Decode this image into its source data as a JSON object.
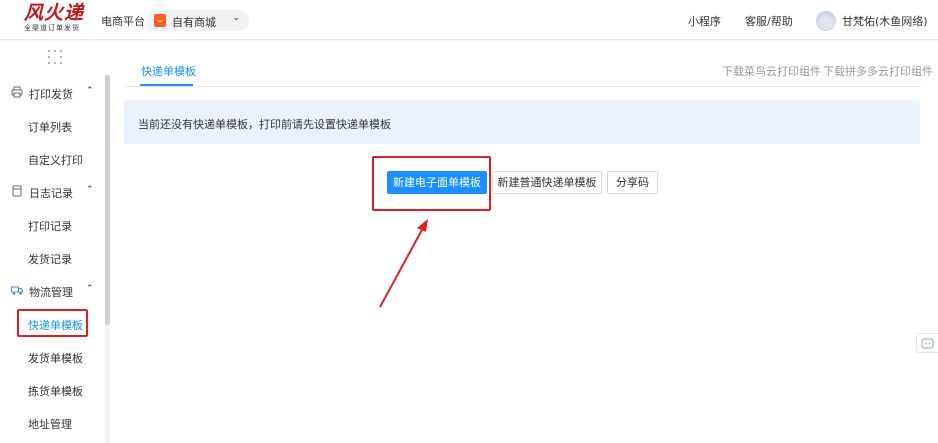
{
  "header": {
    "logo_text": "风火递",
    "logo_subtext": "全渠道订单发货",
    "platform_label": "电商平台",
    "store_select_value": "自有商城",
    "nav_links": [
      "小程序",
      "客服/帮助"
    ],
    "user_name": "甘梵佑(木鱼网络)"
  },
  "sidebar": {
    "groups": [
      {
        "label": "打印发货",
        "icon": "printer-icon",
        "items": [
          "订单列表",
          "自定义打印"
        ]
      },
      {
        "label": "日志记录",
        "icon": "document-icon",
        "items": [
          "打印记录",
          "发货记录"
        ]
      },
      {
        "label": "物流管理",
        "icon": "truck-icon",
        "items": [
          "快递单模板",
          "发货单模板",
          "拣货单模板",
          "地址管理"
        ]
      }
    ],
    "active_item": "快递单模板"
  },
  "main": {
    "tab_label": "快递单模板",
    "download_links": [
      "下载菜鸟云打印组件",
      "下载拼多多云打印组件"
    ],
    "notice_text": "当前还没有快递单模板，打印前请先设置快递单模板",
    "buttons": {
      "new_electronic": "新建电子面单模板",
      "new_regular": "新建普通快递单模板",
      "share_code": "分享码"
    }
  },
  "colors": {
    "accent": "#1890ff",
    "brand_red": "#c8151d",
    "highlight_red": "#e02020"
  }
}
